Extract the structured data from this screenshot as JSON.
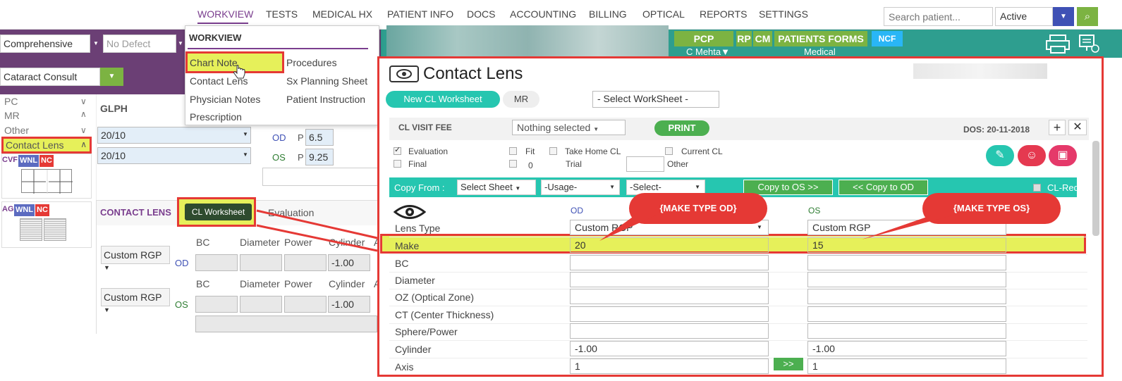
{
  "nav": {
    "items": [
      "WORKVIEW",
      "TESTS",
      "MEDICAL HX",
      "PATIENT INFO",
      "DOCS",
      "ACCOUNTING",
      "BILLING",
      "OPTICAL",
      "REPORTS",
      "SETTINGS"
    ],
    "search_placeholder": "Search patient...",
    "status_value": "Active"
  },
  "toolbar": {
    "exam_type": "Comprehensive",
    "defect": "No Defect",
    "visit_type": "Cataract Consult"
  },
  "header_tabs": {
    "pcp": "PCP",
    "pcp_sub": "C Mehta▼",
    "rp": "RP",
    "cm": "CM",
    "patients_forms": "PATIENTS FORMS",
    "patients_forms_sub": "Medical",
    "ncf": "NCF"
  },
  "menu": {
    "title": "WORKVIEW",
    "col1": [
      "Chart Note",
      "Contact Lens",
      "Physician Notes",
      "Prescription"
    ],
    "col2": [
      "Procedures",
      "Sx Planning Sheet",
      "Patient Instruction"
    ]
  },
  "leftnav": {
    "items": [
      "PC",
      "MR",
      "Other"
    ],
    "contact_lens": "Contact Lens",
    "cvf": "CVF",
    "ag": "AG",
    "wnl": "WNL",
    "nc": "NC"
  },
  "glph": {
    "title": "GLPH",
    "row1": "20/10",
    "row2": "20/10",
    "od": "OD",
    "os": "OS",
    "p": "P",
    "od_val": "6.5",
    "os_val": "9.25"
  },
  "contact_lens_section": {
    "title": "CONTACT LENS",
    "worksheet_btn": "CL Worksheet",
    "evaluation": "Evaluation",
    "cols": [
      "BC",
      "Diameter",
      "Power",
      "Cylinder"
    ],
    "od_type": "Custom RGP",
    "os_type": "Custom RGP",
    "od": "OD",
    "os": "OS",
    "od_cyl": "-1.00",
    "os_cyl": "-1.00"
  },
  "dialog": {
    "title": "Contact Lens",
    "new_worksheet": "New CL Worksheet",
    "mr": "MR",
    "select_worksheet": "- Select WorkSheet -",
    "visit_fee_label": "CL VISIT FEE",
    "nothing_selected": "Nothing selected",
    "print": "PRINT",
    "dos": "DOS: 20-11-2018",
    "checks": {
      "evaluation": "Evaluation",
      "final": "Final",
      "fit": "Fit",
      "zero": "0",
      "take_home": "Take Home CL",
      "trial": "Trial",
      "current": "Current CL",
      "other": "Other"
    },
    "copy_from": "Copy From :",
    "select_sheet": "Select Sheet",
    "usage": "-Usage-",
    "select": "-Select-",
    "copy_to_os": "Copy to OS >>",
    "copy_to_od": "<< Copy to OD",
    "cl_req": "CL-Req",
    "od_header": "OD",
    "os_header": "OS",
    "rows": [
      "Lens Type",
      "Make",
      "BC",
      "Diameter",
      "OZ (Optical Zone)",
      "CT (Center Thickness)",
      "Sphere/Power",
      "Cylinder",
      "Axis"
    ],
    "od_values": [
      "Custom RGP",
      "20",
      "",
      "",
      "",
      "",
      "",
      "-1.00",
      "1"
    ],
    "os_values": [
      "Custom RGP",
      "15",
      "",
      "",
      "",
      "",
      "",
      "-1.00",
      "1"
    ],
    "axis_copy": ">>",
    "callout_od": "{MAKE TYPE OD}",
    "callout_os": "{MAKE TYPE OS}"
  }
}
